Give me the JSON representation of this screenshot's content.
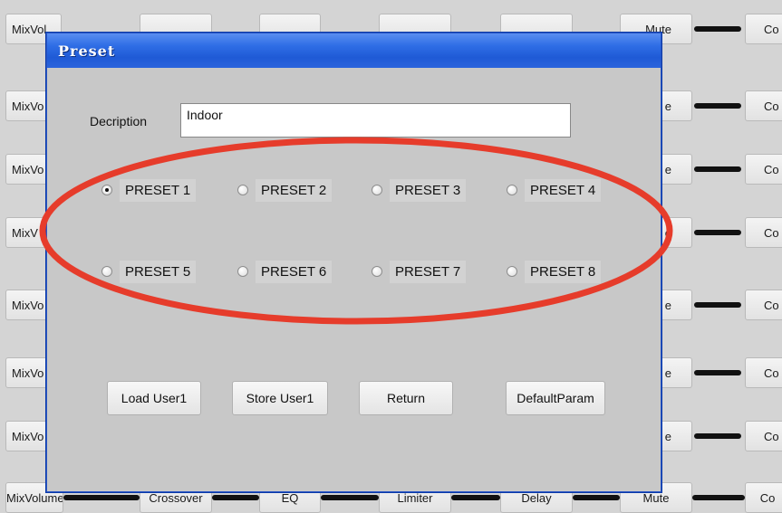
{
  "background": {
    "column_labels": [
      "MixVolume",
      "Crossover",
      "EQ",
      "Limiter",
      "Delay",
      "Mute",
      "Co"
    ],
    "row_labels": [
      "MixVol",
      "MixVo",
      "MixVo",
      "MixV",
      "MixVo",
      "MixVo",
      "MixVo"
    ],
    "row_right_labels": [
      "te",
      "e",
      "e",
      "e",
      "e",
      "e",
      "e"
    ],
    "top_row": [
      "MixVol",
      "",
      "",
      "",
      "",
      "Mute",
      "Co"
    ]
  },
  "dialog": {
    "title": "Preset",
    "description_label": "Decription",
    "description_value": "Indoor",
    "presets": [
      {
        "label": "PRESET 1",
        "checked": true
      },
      {
        "label": "PRESET 2",
        "checked": false
      },
      {
        "label": "PRESET 3",
        "checked": false
      },
      {
        "label": "PRESET 4",
        "checked": false
      },
      {
        "label": "PRESET 5",
        "checked": false
      },
      {
        "label": "PRESET 6",
        "checked": false
      },
      {
        "label": "PRESET 7",
        "checked": false
      },
      {
        "label": "PRESET 8",
        "checked": false
      }
    ],
    "buttons": {
      "load": "Load User1",
      "store": "Store User1",
      "return": "Return",
      "default": "DefaultParam"
    }
  },
  "annotation_color": "#e63c2b"
}
